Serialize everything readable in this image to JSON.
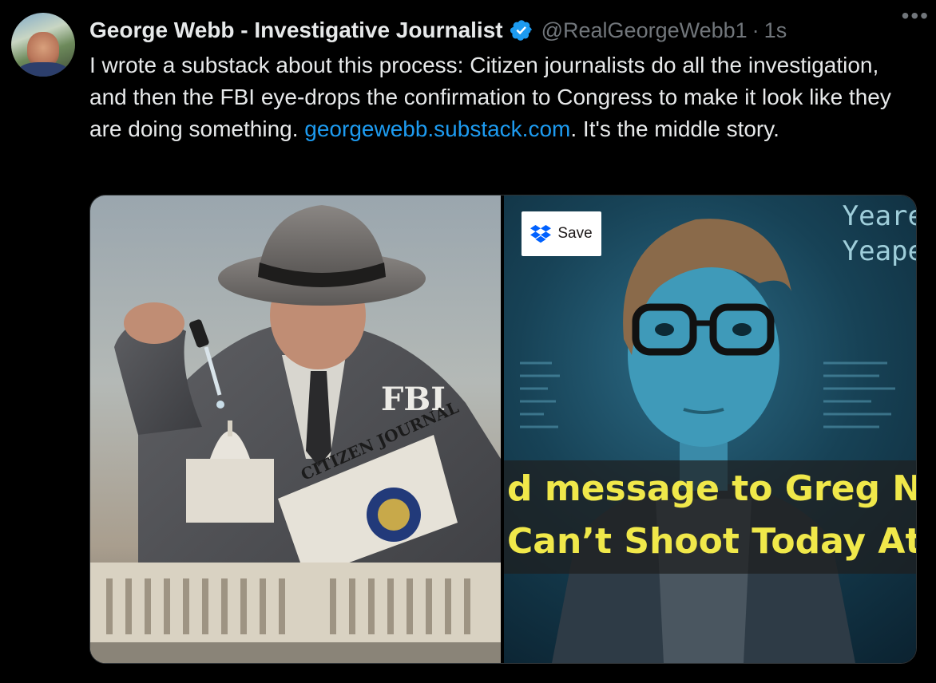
{
  "tweet": {
    "author_name": "George Webb - Investigative Journalist",
    "handle": "@RealGeorgeWebb1",
    "separator": "·",
    "timestamp": "1s",
    "more_label": "•••",
    "text_part1": "I wrote a substack about this process: Citizen journalists do all the investigation, and then the FBI eye-drops the confirmation to Congress to make it look like they are doing something. ",
    "link_text": "georgewebb.substack.com",
    "text_part2": ". It's the middle story."
  },
  "media": {
    "left_image": {
      "fbi_label": "FBI",
      "newspaper_title": "CITIZEN JOURNAL"
    },
    "right_image": {
      "save_button_label": "Save",
      "screen_text_1": "Yeare",
      "screen_text_2": "Yeape",
      "caption_line_1": "d message to Greg Ni",
      "caption_line_2": "Can’t Shoot Today At"
    }
  },
  "colors": {
    "background": "#000000",
    "text_primary": "#e7e9ea",
    "text_secondary": "#71767b",
    "link": "#1d9bf0",
    "verified_badge": "#1d9bf0",
    "caption_yellow": "#f0e84a"
  },
  "icons": {
    "verified": "verified-badge-icon",
    "more": "more-options-icon",
    "save": "dropbox-icon"
  }
}
